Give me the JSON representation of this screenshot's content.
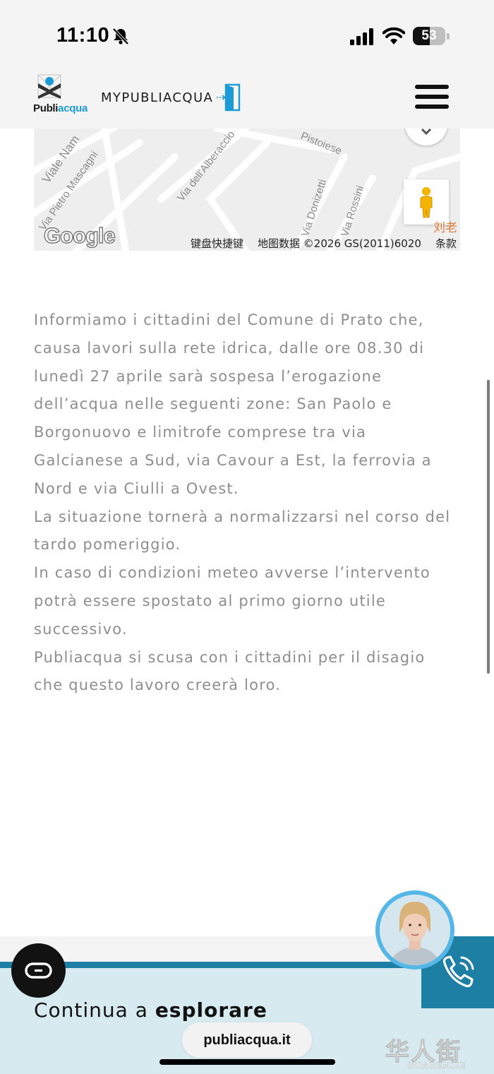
{
  "status_bar": {
    "time": "11:10",
    "battery_level": "53",
    "battery_fraction": 0.53,
    "silent_mode": true,
    "icons": [
      "bell-off-icon",
      "cellular-signal-icon",
      "wifi-icon",
      "battery-icon"
    ]
  },
  "header": {
    "logo_text_prefix": "Publi",
    "logo_text_suffix": "acqua",
    "mypubliacqua_label": "MYPUBLIACQUA",
    "icons": [
      "publiacqua-logo",
      "door-login-icon",
      "hamburger-menu-icon"
    ],
    "accent_color": "#1b9ad6"
  },
  "map": {
    "streets": [
      "Viale Nam",
      "Via Pietro Mascagni",
      "Via dell'Alberaccio",
      "Pistoiese",
      "Via Donizetti",
      "Via Rossini"
    ],
    "poi_label": "刘老",
    "google_label": "Google",
    "keyboard_shortcuts": "键盘快捷键",
    "map_data": "地图数据 ©2026 GS(2011)6020",
    "terms": "条款",
    "icons": [
      "chevron-down-icon",
      "pegman-icon"
    ]
  },
  "article": {
    "paragraphs": [
      "Informiamo i cittadini del Comune di Prato che, causa lavori sulla rete idrica, dalle ore 08.30 di lunedì 27 aprile sarà sospesa l’erogazione dell’acqua nelle seguenti zone: San Paolo e Borgonuovo e limitrofe comprese tra via Galcianese a Sud, via Cavour a Est, la ferrovia a Nord e via Ciulli a Ovest.",
      "La situazione tornerà a normalizzarsi nel corso del tardo pomeriggio.",
      "In caso di condizioni meteo avverse l’intervento potrà essere spostato al primo giorno utile successivo.",
      "Publiacqua si scusa con i cittadini per il disagio che questo lavoro creerà loro."
    ]
  },
  "explore": {
    "prefix": "Continua a",
    "bold": "esplorare",
    "brand_color": "#1c7fa3"
  },
  "widgets": {
    "icons": [
      "assistant-avatar",
      "phone-call-icon",
      "reader-mode-icon"
    ]
  },
  "browser": {
    "url": "publiacqua.it"
  },
  "watermark": {
    "chinese": "华人街",
    "latin": "HUARENJIE"
  }
}
